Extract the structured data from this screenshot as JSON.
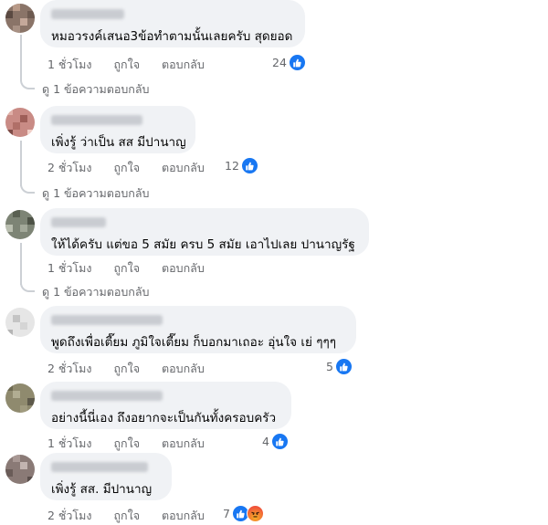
{
  "comments": [
    {
      "text": "หมอวรงค์เสนอ3ข้อทำตามนั้นเลยครับ สุดยอด",
      "time": "1 ชั่วโมง",
      "like": "ถูกใจ",
      "reply": "ตอบกลับ",
      "reactions": "24",
      "reaction_icons": [
        "like-icon"
      ],
      "replies_link": "ดู 1 ข้อความตอบกลับ"
    },
    {
      "text": "เพิ่งรู้ ว่าเป็น สส มีปานาญ",
      "time": "2 ชั่วโมง",
      "like": "ถูกใจ",
      "reply": "ตอบกลับ",
      "reactions": "12",
      "reaction_icons": [
        "like-icon"
      ],
      "replies_link": "ดู 1 ข้อความตอบกลับ"
    },
    {
      "text": "ให้ได้ครับ แต่ขอ 5 สมัย ครบ 5 สมัย เอาไปเลย ปานาญรัฐ",
      "time": "1 ชั่วโมง",
      "like": "ถูกใจ",
      "reply": "ตอบกลับ",
      "reactions": "",
      "reaction_icons": [],
      "replies_link": "ดู 1 ข้อความตอบกลับ"
    },
    {
      "text": "พูดถึงเพื่อเตี๊ยม ภูมิใจเตี๊ยม ก็บอกมาเถอะ อุ่นใจ เย่ ๆๆๆ",
      "time": "2 ชั่วโมง",
      "like": "ถูกใจ",
      "reply": "ตอบกลับ",
      "reactions": "5",
      "reaction_icons": [
        "like-icon"
      ]
    },
    {
      "text": "อย่างนี้นี่เอง ถึงอยากจะเป็นกันทั้งครอบครัว",
      "time": "1 ชั่วโมง",
      "like": "ถูกใจ",
      "reply": "ตอบกลับ",
      "reactions": "4",
      "reaction_icons": [
        "like-icon"
      ]
    },
    {
      "text": "เพิ่งรู้ สส. มีปานาญ",
      "time": "2 ชั่วโมง",
      "like": "ถูกใจ",
      "reply": "ตอบกลับ",
      "reactions": "7",
      "reaction_icons": [
        "like-icon",
        "angry-icon"
      ]
    }
  ],
  "colors": {
    "bubble": "#f0f2f5",
    "meta_text": "#65676b",
    "like_blue": "#1877f2",
    "angry": "#f0533b"
  }
}
